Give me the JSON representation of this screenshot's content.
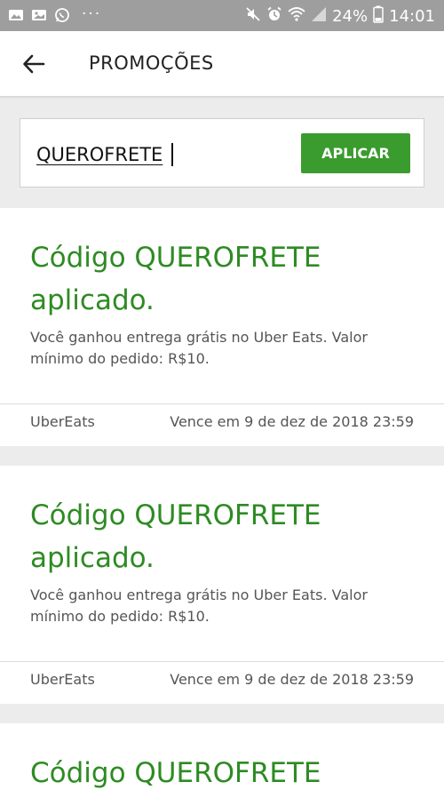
{
  "status_bar": {
    "battery": "24%",
    "time": "14:01",
    "icons": [
      "gallery-icon",
      "image-icon",
      "whatsapp-icon",
      "more-icon",
      "mute-icon",
      "alarm-icon",
      "wifi-icon",
      "signal-icon",
      "battery-icon"
    ]
  },
  "header": {
    "back_icon": "arrow-left-icon",
    "title": "PROMOÇÕES"
  },
  "promo": {
    "code_value": "QUEROFRETE",
    "apply_label": "APLICAR"
  },
  "cards": [
    {
      "title": "Código QUEROFRETE aplicado.",
      "description": "Você ganhou entrega grátis no Uber Eats. Valor mínimo do pedido: R$10.",
      "service": "UberEats",
      "expiry": "Vence em 9 de dez de 2018 23:59"
    },
    {
      "title": "Código QUEROFRETE aplicado.",
      "description": "Você ganhou entrega grátis no Uber Eats. Valor mínimo do pedido: R$10.",
      "service": "UberEats",
      "expiry": "Vence em 9 de dez de 2018 23:59"
    },
    {
      "title": "Código QUEROFRETE"
    }
  ],
  "colors": {
    "accent_green": "#3a9c2e",
    "title_green": "#2e8b23",
    "status_bar": "#9e9e9e",
    "background": "#ececec"
  }
}
